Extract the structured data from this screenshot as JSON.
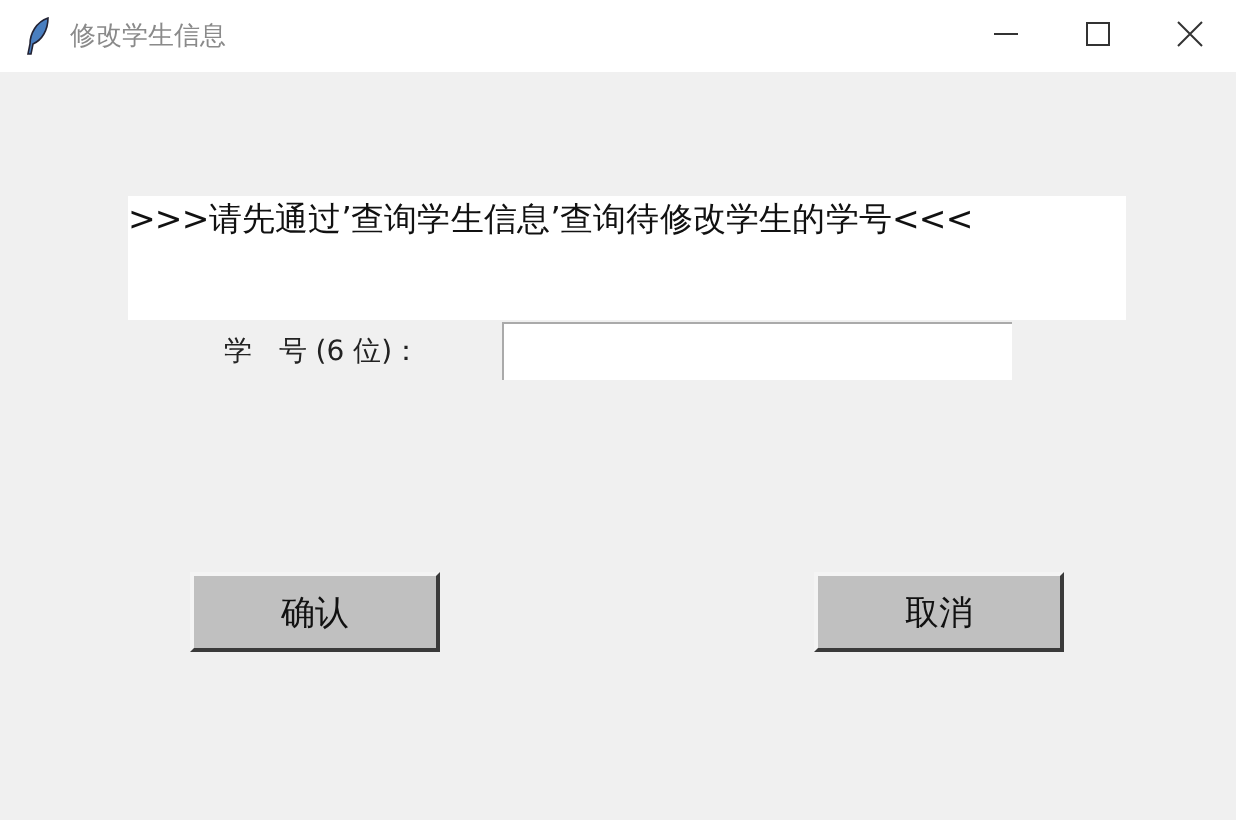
{
  "window": {
    "title": "修改学生信息"
  },
  "message": ">>>请先通过’查询学生信息’查询待修改学生的学号<<<",
  "student_id": {
    "label": "学   号 (6 位)："
  },
  "buttons": [
    "确认",
    "取消"
  ]
}
